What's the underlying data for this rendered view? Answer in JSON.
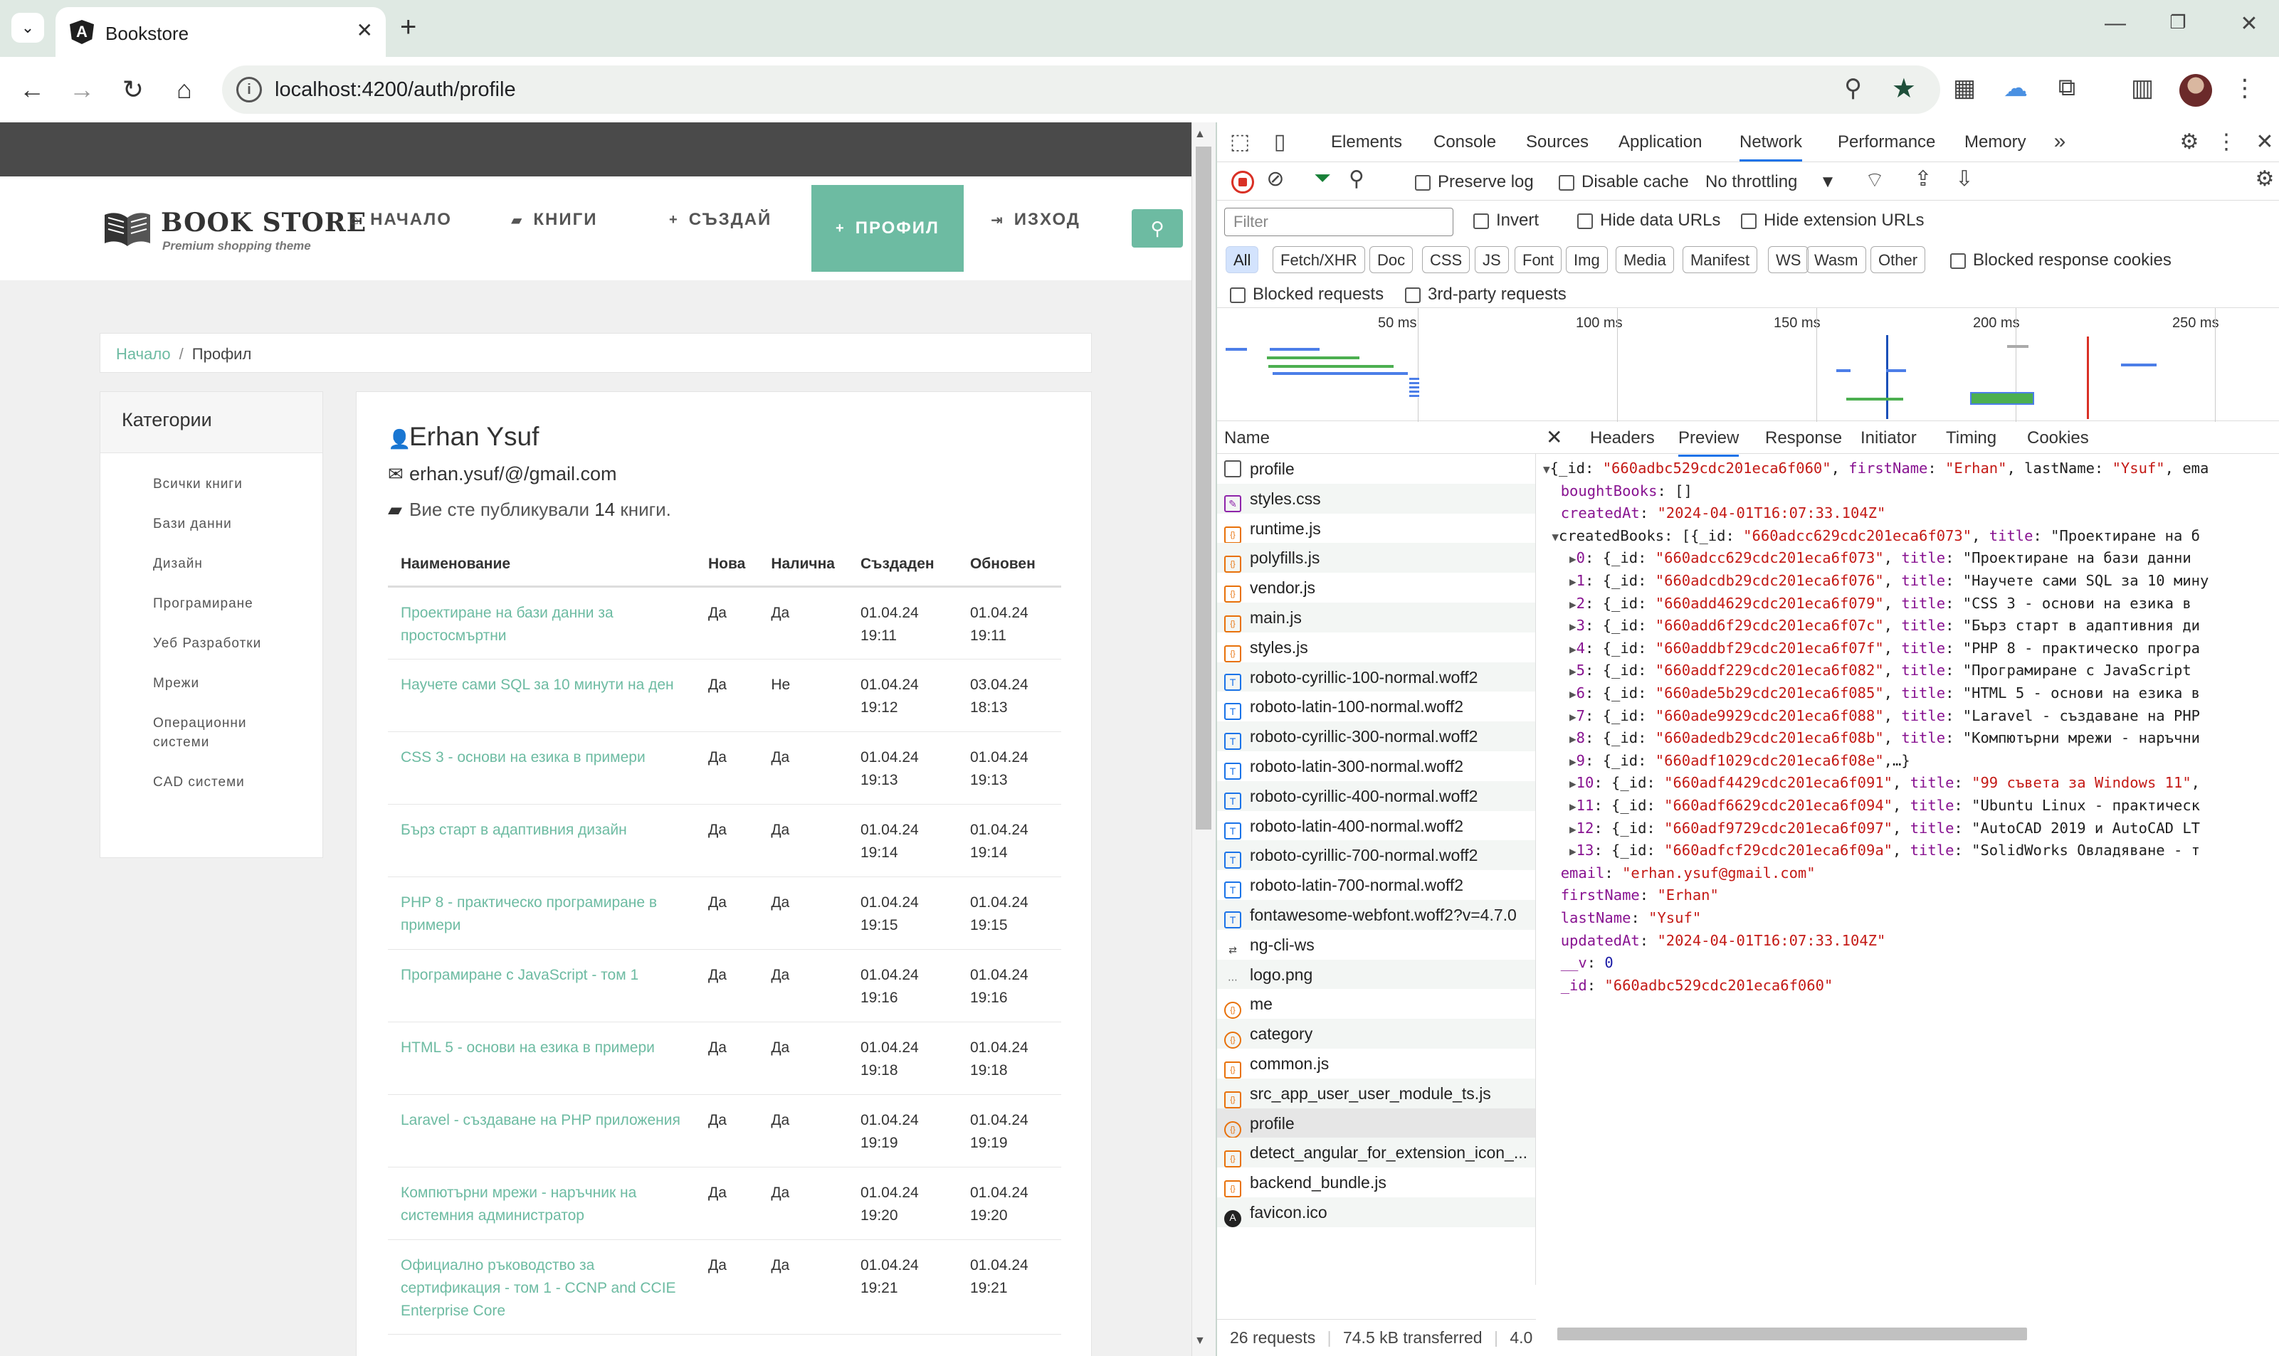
{
  "browser": {
    "tab_title": "Bookstore",
    "url": "localhost:4200/auth/profile"
  },
  "site": {
    "logo_title": "BOOK STORE",
    "logo_subtitle": "Premium shopping theme",
    "nav": [
      {
        "icon": "home-icon",
        "label": "НАЧАЛО"
      },
      {
        "icon": "book-icon",
        "label": "КНИГИ"
      },
      {
        "icon": "plus-icon",
        "label": "СЪЗДАЙ"
      },
      {
        "icon": "plus-icon",
        "label": "ПРОФИЛ"
      },
      {
        "icon": "signout-icon",
        "label": "ИЗХОД"
      }
    ],
    "accent_color": "#6dbba2"
  },
  "breadcrumb": {
    "home": "Начало",
    "current": "Профил"
  },
  "categories": {
    "title": "Категории",
    "items": [
      "Всички книги",
      "Бази данни",
      "Дизайн",
      "Програмиране",
      "Уеб Разработки",
      "Мрежи",
      "Операционни системи",
      "CAD системи"
    ]
  },
  "profile": {
    "name": "Erhan Ysuf",
    "email": "erhan.ysuf/@/gmail.com",
    "books_prefix": "Вие сте публикували",
    "books_count": "14",
    "books_suffix": "книги."
  },
  "table": {
    "headers": [
      "Наименование",
      "Нова",
      "Налична",
      "Създаден",
      "Обновен"
    ],
    "rows": [
      {
        "title": "Проектиране на бази данни за простосмъртни",
        "new": "Да",
        "available": "Да",
        "created_date": "01.04.24",
        "created_time": "19:11",
        "updated_date": "01.04.24",
        "updated_time": "19:11"
      },
      {
        "title": "Научете сами SQL за 10 минути на ден",
        "new": "Да",
        "available": "Не",
        "created_date": "01.04.24",
        "created_time": "19:12",
        "updated_date": "03.04.24",
        "updated_time": "18:13"
      },
      {
        "title": "CSS 3 - основи на езика в примери",
        "new": "Да",
        "available": "Да",
        "created_date": "01.04.24",
        "created_time": "19:13",
        "updated_date": "01.04.24",
        "updated_time": "19:13"
      },
      {
        "title": "Бърз старт в адаптивния дизайн",
        "new": "Да",
        "available": "Да",
        "created_date": "01.04.24",
        "created_time": "19:14",
        "updated_date": "01.04.24",
        "updated_time": "19:14"
      },
      {
        "title": "PHP 8 - практическо програмиране в примери",
        "new": "Да",
        "available": "Да",
        "created_date": "01.04.24",
        "created_time": "19:15",
        "updated_date": "01.04.24",
        "updated_time": "19:15"
      },
      {
        "title": "Програмиране с JavaScript - том 1",
        "new": "Да",
        "available": "Да",
        "created_date": "01.04.24",
        "created_time": "19:16",
        "updated_date": "01.04.24",
        "updated_time": "19:16"
      },
      {
        "title": "HTML 5 - основи на езика в примери",
        "new": "Да",
        "available": "Да",
        "created_date": "01.04.24",
        "created_time": "19:18",
        "updated_date": "01.04.24",
        "updated_time": "19:18"
      },
      {
        "title": "Laravel - създаване на PHP приложения",
        "new": "Да",
        "available": "Да",
        "created_date": "01.04.24",
        "created_time": "19:19",
        "updated_date": "01.04.24",
        "updated_time": "19:19"
      },
      {
        "title": "Компютърни мрежи - наръчник на системния администратор",
        "new": "Да",
        "available": "Да",
        "created_date": "01.04.24",
        "created_time": "19:20",
        "updated_date": "01.04.24",
        "updated_time": "19:20"
      },
      {
        "title": "Официално ръководство за сертификация - том 1 - CCNP and CCIE Enterprise Core",
        "new": "Да",
        "available": "Да",
        "created_date": "01.04.24",
        "created_time": "19:21",
        "updated_date": "01.04.24",
        "updated_time": "19:21"
      }
    ]
  },
  "devtools": {
    "tabs": [
      "Elements",
      "Console",
      "Sources",
      "Application",
      "Network",
      "Performance",
      "Memory"
    ],
    "active_tab": "Network",
    "toolbar": {
      "preserve_log": "Preserve log",
      "disable_cache": "Disable cache",
      "throttling": "No throttling"
    },
    "filter_placeholder": "Filter",
    "filter_options": {
      "invert": "Invert",
      "hide_data_urls": "Hide data URLs",
      "hide_extension_urls": "Hide extension URLs"
    },
    "types": [
      "All",
      "Fetch/XHR",
      "Doc",
      "CSS",
      "JS",
      "Font",
      "Img",
      "Media",
      "Manifest",
      "WS",
      "Wasm",
      "Other"
    ],
    "blocked_cookies": "Blocked response cookies",
    "blocked_requests": "Blocked requests",
    "third_party": "3rd-party requests",
    "timeline_labels": [
      "50 ms",
      "100 ms",
      "150 ms",
      "200 ms",
      "250 ms"
    ],
    "name_header": "Name",
    "requests": [
      {
        "name": "profile",
        "type": "doc"
      },
      {
        "name": "styles.css",
        "type": "css"
      },
      {
        "name": "runtime.js",
        "type": "js"
      },
      {
        "name": "polyfills.js",
        "type": "js"
      },
      {
        "name": "vendor.js",
        "type": "js"
      },
      {
        "name": "main.js",
        "type": "js"
      },
      {
        "name": "styles.js",
        "type": "js"
      },
      {
        "name": "roboto-cyrillic-100-normal.woff2",
        "type": "font"
      },
      {
        "name": "roboto-latin-100-normal.woff2",
        "type": "font"
      },
      {
        "name": "roboto-cyrillic-300-normal.woff2",
        "type": "font"
      },
      {
        "name": "roboto-latin-300-normal.woff2",
        "type": "font"
      },
      {
        "name": "roboto-cyrillic-400-normal.woff2",
        "type": "font"
      },
      {
        "name": "roboto-latin-400-normal.woff2",
        "type": "font"
      },
      {
        "name": "roboto-cyrillic-700-normal.woff2",
        "type": "font"
      },
      {
        "name": "roboto-latin-700-normal.woff2",
        "type": "font"
      },
      {
        "name": "fontawesome-webfont.woff2?v=4.7.0",
        "type": "font"
      },
      {
        "name": "ng-cli-ws",
        "type": "ws"
      },
      {
        "name": "logo.png",
        "type": "img"
      },
      {
        "name": "me",
        "type": "xhr"
      },
      {
        "name": "category",
        "type": "xhr"
      },
      {
        "name": "common.js",
        "type": "js"
      },
      {
        "name": "src_app_user_user_module_ts.js",
        "type": "js"
      },
      {
        "name": "profile",
        "type": "xhr"
      },
      {
        "name": "detect_angular_for_extension_icon_...",
        "type": "js"
      },
      {
        "name": "backend_bundle.js",
        "type": "js"
      },
      {
        "name": "favicon.ico",
        "type": "fav"
      }
    ],
    "selected_request": 22,
    "detail_tabs": [
      "Headers",
      "Preview",
      "Response",
      "Initiator",
      "Timing",
      "Cookies"
    ],
    "active_detail_tab": "Preview",
    "preview_lines": [
      "▼{_id: \"660adbc529cdc201eca6f060\", firstName: \"Erhan\", lastName: \"Ysuf\", ema",
      "  boughtBooks: []",
      "  createdAt: \"2024-04-01T16:07:33.104Z\"",
      " ▼createdBooks: [{_id: \"660adcc629cdc201eca6f073\", title: \"Проектиране на б",
      "   ▶0: {_id: \"660adcc629cdc201eca6f073\", title: \"Проектиране на бази данни",
      "   ▶1: {_id: \"660adcdb29cdc201eca6f076\", title: \"Научете сами SQL за 10 мину",
      "   ▶2: {_id: \"660add4629cdc201eca6f079\", title: \"CSS 3 - основи на езика в",
      "   ▶3: {_id: \"660add6f29cdc201eca6f07c\", title: \"Бърз старт в адаптивния ди",
      "   ▶4: {_id: \"660addbf29cdc201eca6f07f\", title: \"PHP 8 - практическо програ",
      "   ▶5: {_id: \"660addf229cdc201eca6f082\", title: \"Програмиране с JavaScript",
      "   ▶6: {_id: \"660ade5b29cdc201eca6f085\", title: \"HTML 5 - основи на езика в",
      "   ▶7: {_id: \"660ade9929cdc201eca6f088\", title: \"Laravel - създаване на PHP",
      "   ▶8: {_id: \"660adedb29cdc201eca6f08b\", title: \"Компютърни мрежи - наръчни",
      "   ▶9: {_id: \"660adf1029cdc201eca6f08e\",…}",
      "   ▶10: {_id: \"660adf4429cdc201eca6f091\", title: \"99 съвета за Windows 11\",",
      "   ▶11: {_id: \"660adf6629cdc201eca6f094\", title: \"Ubuntu Linux - практическ",
      "   ▶12: {_id: \"660adf9729cdc201eca6f097\", title: \"AutoCAD 2019 и AutoCAD LT",
      "   ▶13: {_id: \"660adfcf29cdc201eca6f09a\", title: \"SolidWorks Овладяване - т",
      "  email: \"erhan.ysuf@gmail.com\"",
      "  firstName: \"Erhan\"",
      "  lastName: \"Ysuf\"",
      "  updatedAt: \"2024-04-01T16:07:33.104Z\"",
      "  __v: 0",
      "  _id: \"660adbc529cdc201eca6f060\""
    ],
    "status": {
      "requests": "26 requests",
      "transferred": "74.5 kB transferred",
      "extra": "4.0"
    }
  }
}
